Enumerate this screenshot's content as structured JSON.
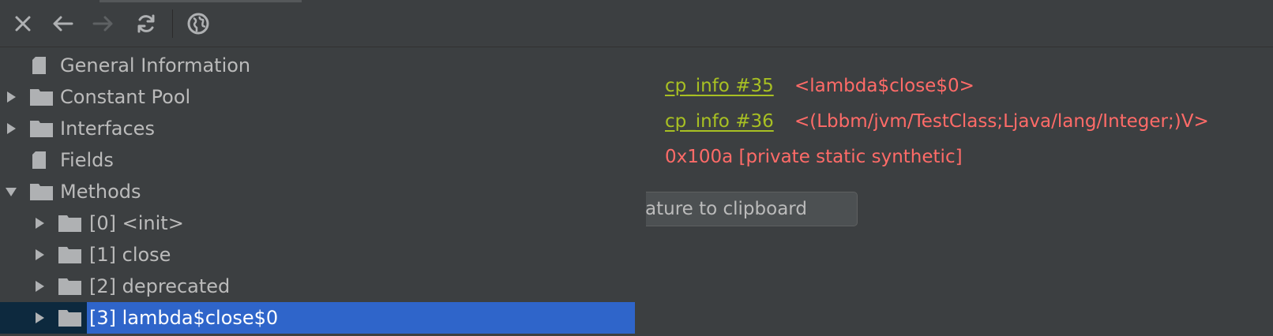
{
  "toolbar": {
    "close_icon": "close-icon",
    "back_icon": "arrow-left-icon",
    "forward_icon": "arrow-right-icon",
    "refresh_icon": "refresh-icon",
    "web_icon": "globe-icon"
  },
  "tree": {
    "items": [
      {
        "label": "General Information",
        "icon": "file-icon",
        "expandable": false
      },
      {
        "label": "Constant Pool",
        "icon": "folder-icon",
        "expandable": true,
        "expanded": false
      },
      {
        "label": "Interfaces",
        "icon": "folder-icon",
        "expandable": true,
        "expanded": false
      },
      {
        "label": "Fields",
        "icon": "file-icon",
        "expandable": false
      },
      {
        "label": "Methods",
        "icon": "folder-icon",
        "expandable": true,
        "expanded": true
      },
      {
        "label": "[0] <init>",
        "icon": "folder-icon",
        "expandable": true,
        "expanded": false
      },
      {
        "label": "[1] close",
        "icon": "folder-icon",
        "expandable": true,
        "expanded": false
      },
      {
        "label": "[2] deprecated",
        "icon": "folder-icon",
        "expandable": true,
        "expanded": false
      },
      {
        "label": "[3] lambda$close$0",
        "icon": "folder-icon",
        "expandable": true,
        "expanded": false,
        "selected": true
      }
    ]
  },
  "details": {
    "name_link": "cp_info #35",
    "name_value": "<lambda$close$0>",
    "descriptor_link": "cp_info #36",
    "descriptor_value": "<(Lbbm/jvm/TestClass;Ljava/lang/Integer;)V>",
    "access_colon": ":",
    "access_value": "0x100a [private static synthetic]",
    "copy_button": "ature to clipboard"
  },
  "colors": {
    "background": "#3c3f41",
    "selection": "#2f65ca",
    "link": "#a8c023",
    "value": "#ff6b68",
    "text": "#bbbbbb"
  }
}
